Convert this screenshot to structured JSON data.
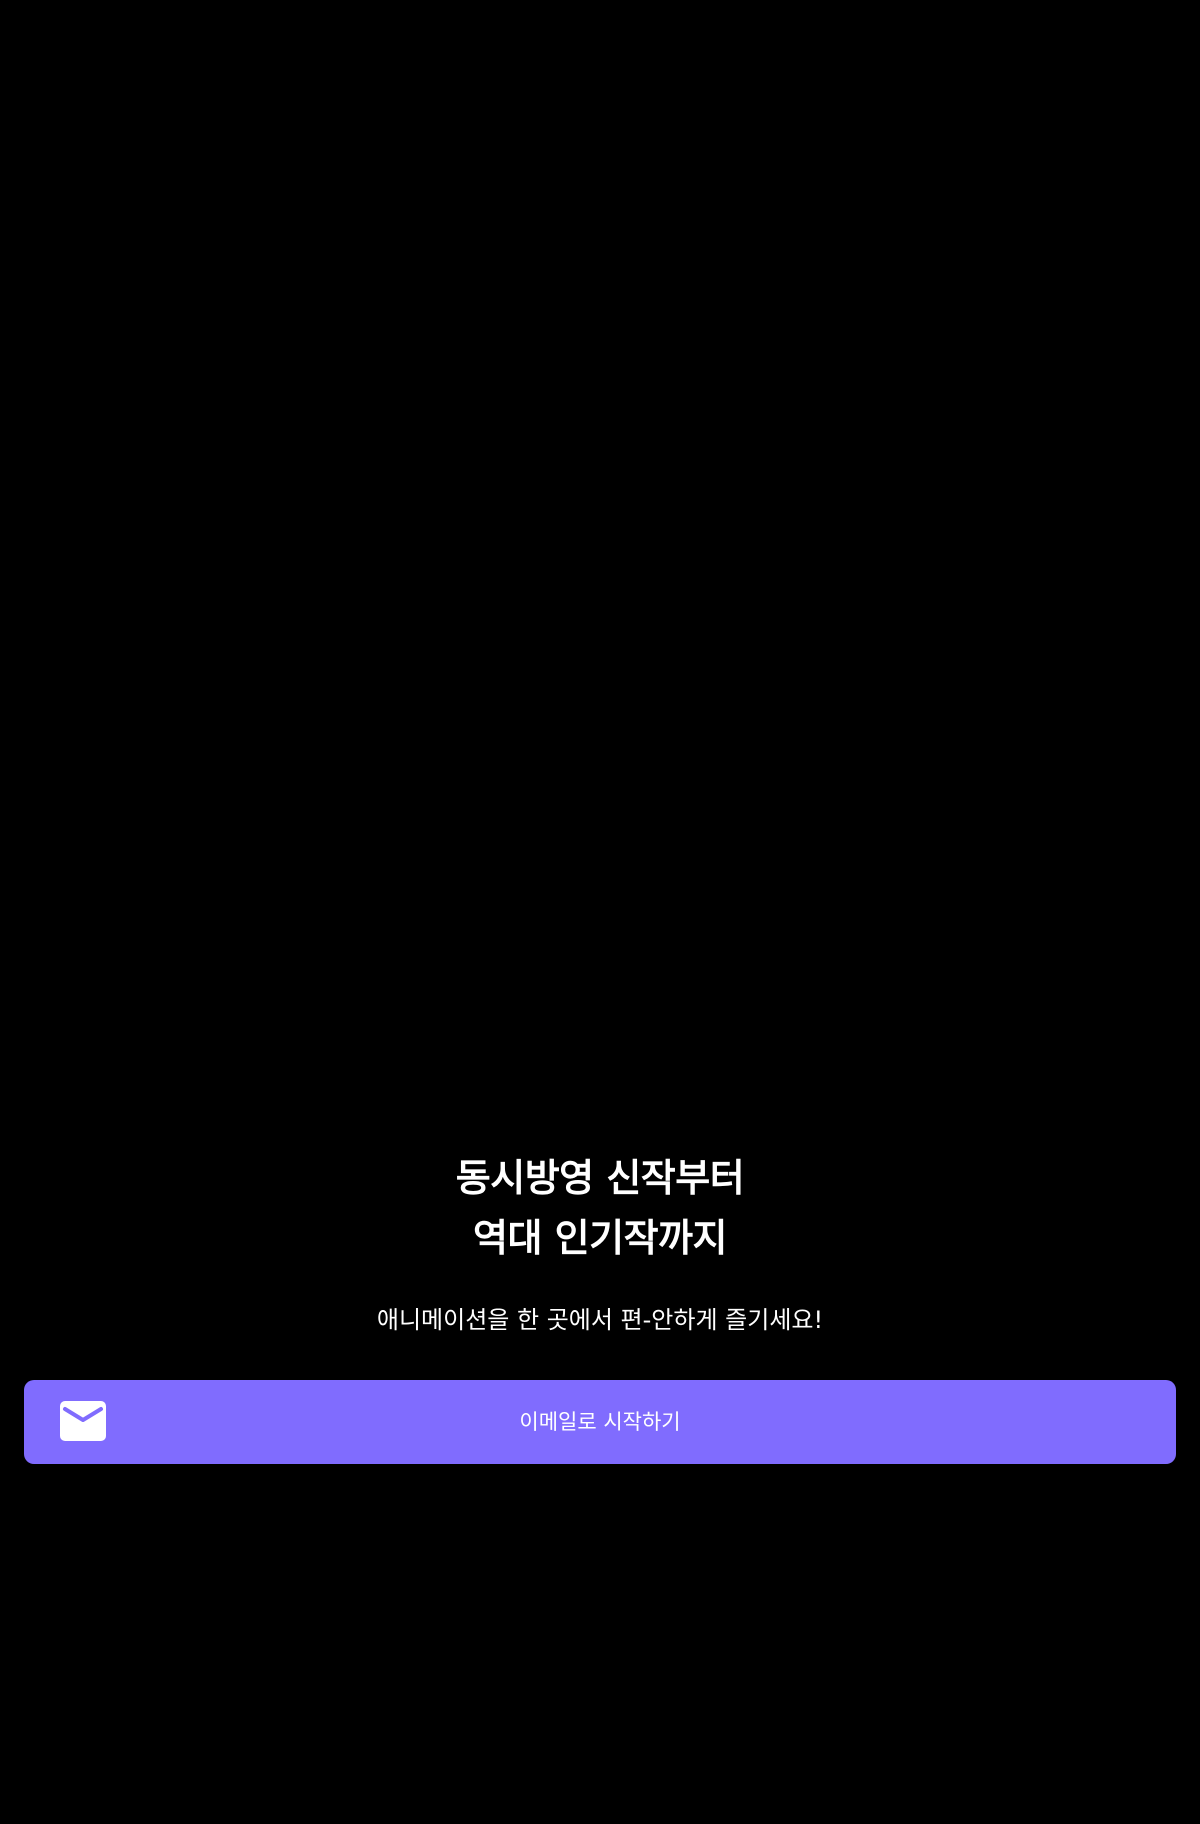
{
  "colors": {
    "background": "#000000",
    "text": "#ffffff",
    "accent": "#806cfe"
  },
  "onboarding": {
    "headline_line1": "동시방영 신작부터",
    "headline_line2": "역대 인기작까지",
    "subtitle": "애니메이션을 한 곳에서 편-안하게 즐기세요!",
    "email_button": {
      "icon": "mail-icon",
      "label": "이메일로 시작하기"
    }
  }
}
